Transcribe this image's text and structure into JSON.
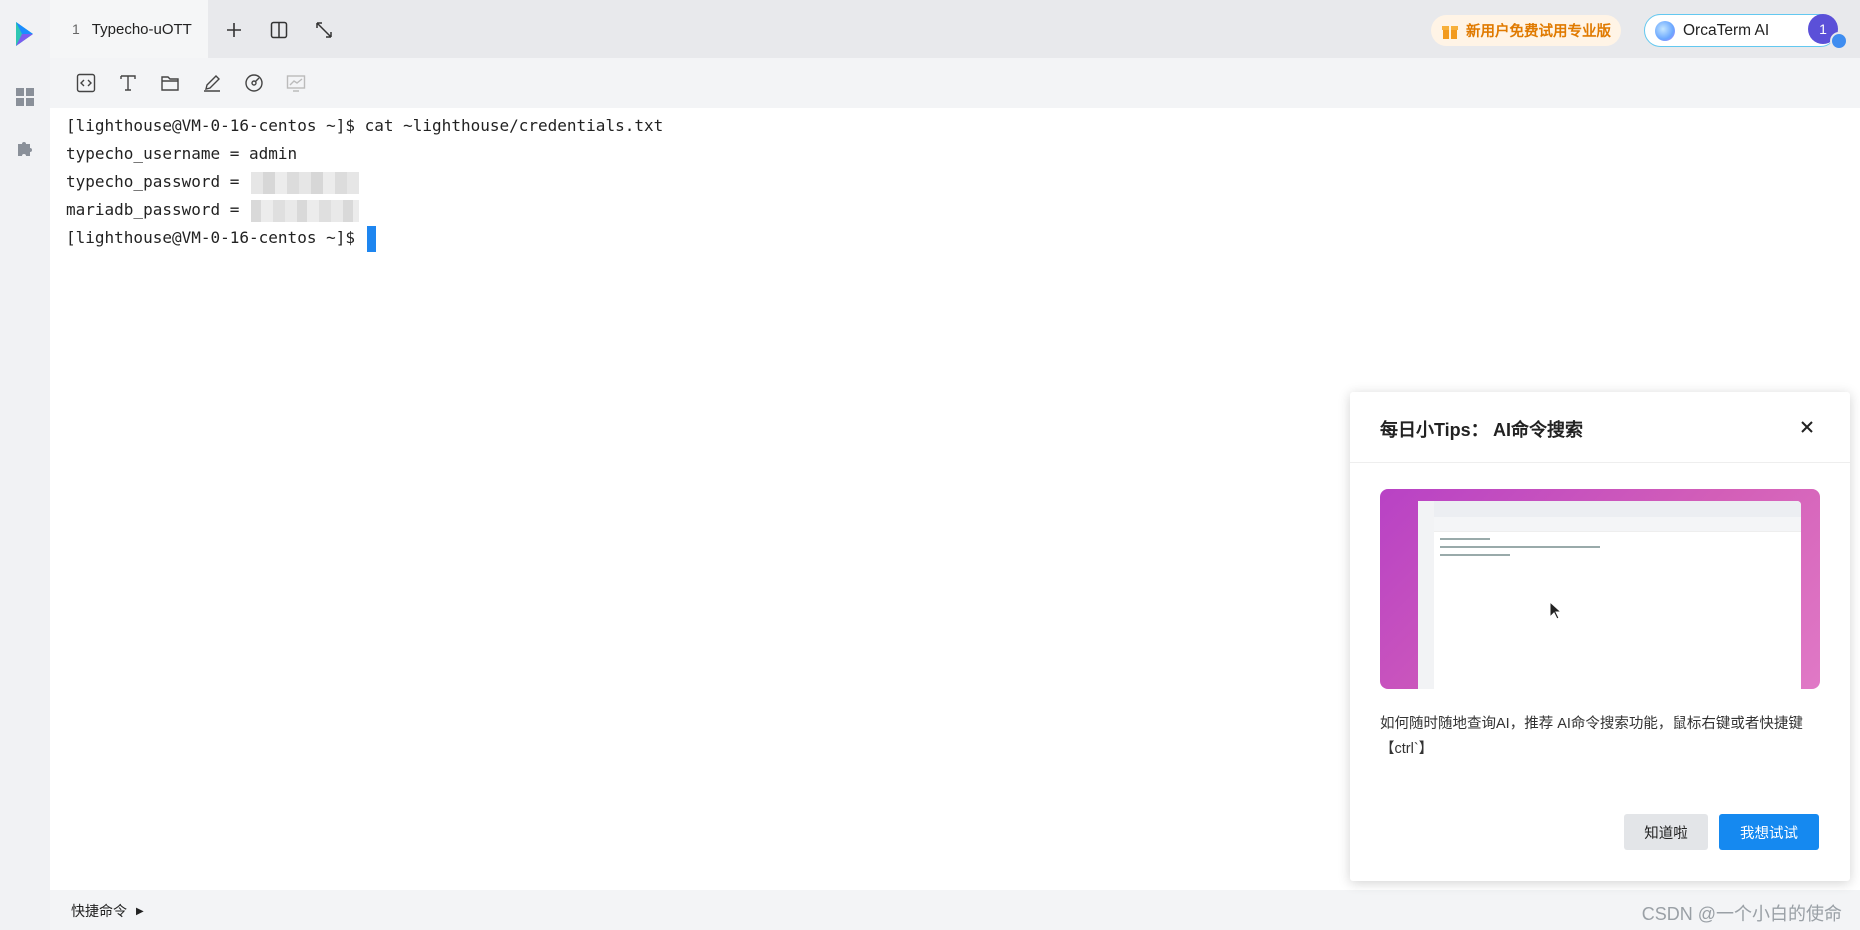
{
  "header": {
    "tab": {
      "index": "1",
      "title": "Typecho-uOTT"
    },
    "promo_label": "新用户免费试用专业版",
    "ai_label": "OrcaTerm AI",
    "avatar_text": "1"
  },
  "terminal": {
    "lines": [
      "[lighthouse@VM-0-16-centos ~]$ cat ~lighthouse/credentials.txt",
      "typecho_username = admin",
      "typecho_password = ",
      "mariadb_password = ",
      "[lighthouse@VM-0-16-centos ~]$ "
    ],
    "cursor_color": "#1e86f0"
  },
  "footer": {
    "quick_commands": "快捷命令",
    "watermark": "CSDN @一个小白的使命"
  },
  "tips_dialog": {
    "title": "每日小Tips： AI命令搜索",
    "description": "如何随时随地查询AI，推荐 AI命令搜索功能，鼠标右键或者快捷键【ctrl`】",
    "dismiss_label": "知道啦",
    "try_label": "我想试试"
  },
  "colors": {
    "accent": "#1589f0",
    "promo": "#e07a00",
    "avatar": "#5b50d8"
  }
}
